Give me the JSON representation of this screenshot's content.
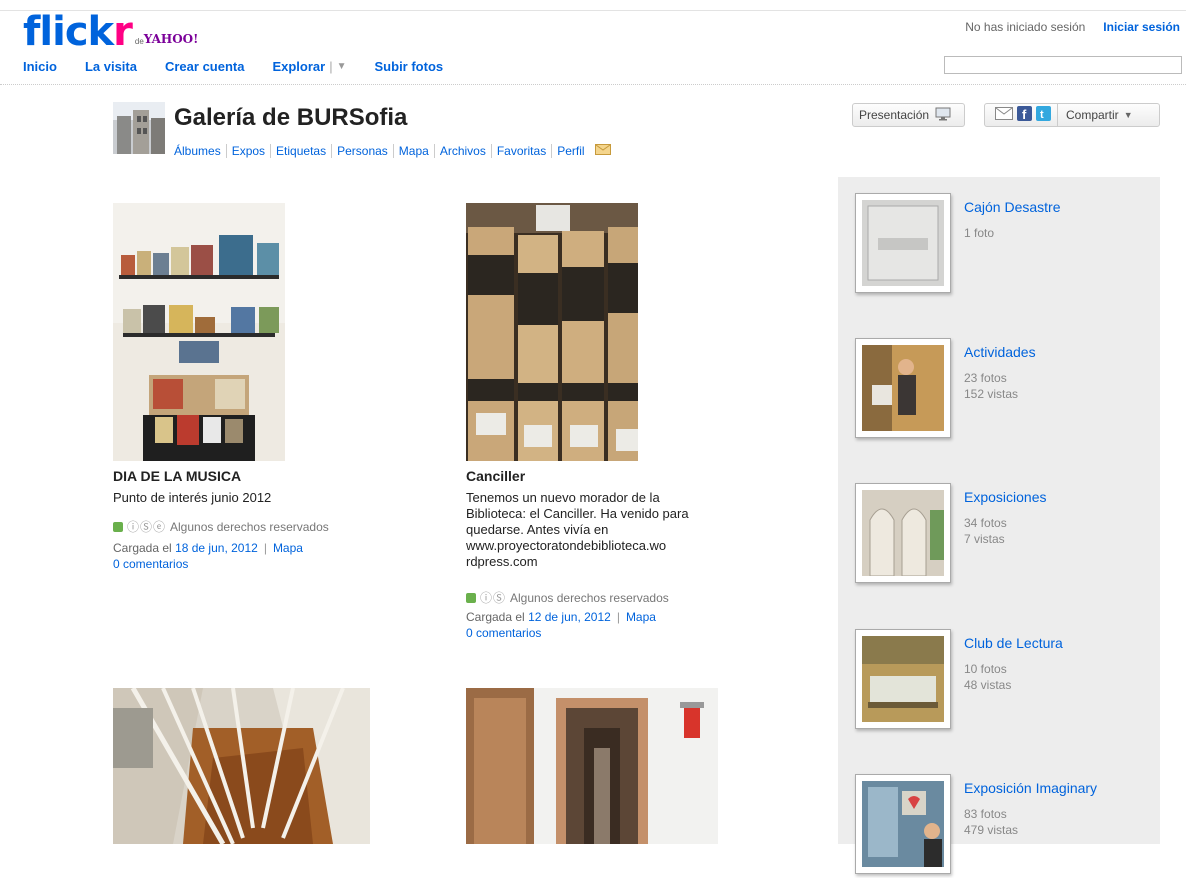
{
  "header": {
    "logo_flick": "flick",
    "logo_r": "r",
    "logo_de": "de",
    "logo_yahoo": "YAHOO!",
    "nav": [
      {
        "label": "Inicio"
      },
      {
        "label": "La visita"
      },
      {
        "label": "Crear cuenta"
      },
      {
        "label": "Explorar"
      },
      {
        "label": "Subir fotos"
      }
    ],
    "status_text": "No has iniciado sesión",
    "signin_label": "Iniciar sesión",
    "search_value": ""
  },
  "gallery": {
    "title": "Galería de BURSofia",
    "subnav": [
      "Álbumes",
      "Expos",
      "Etiquetas",
      "Personas",
      "Mapa",
      "Archivos",
      "Favoritas",
      "Perfil"
    ]
  },
  "toolbar": {
    "presentation_label": "Presentación",
    "share_label": "Compartir"
  },
  "photos": [
    {
      "title": "DIA DE LA MUSICA",
      "description": [
        "Punto de interés junio 2012"
      ],
      "license": "Algunos derechos reservados",
      "uploaded_prefix": "Cargada el",
      "uploaded_date": "18 de jun, 2012",
      "map_label": "Mapa",
      "comments": "0 comentarios"
    },
    {
      "title": "Canciller",
      "description": [
        "Tenemos un nuevo morador de la",
        "Biblioteca: el Canciller. Ha venido para",
        "quedarse. Antes vivía en",
        "www.proyectoratondebiblioteca.wo",
        "rdpress.com"
      ],
      "license": "Algunos derechos reservados",
      "uploaded_prefix": "Cargada el",
      "uploaded_date": "12 de jun, 2012",
      "map_label": "Mapa",
      "comments": "0 comentarios"
    }
  ],
  "sets": [
    {
      "title": "Cajón Desastre",
      "stats": [
        "1 foto"
      ]
    },
    {
      "title": "Actividades",
      "stats": [
        "23 fotos",
        "152 vistas"
      ]
    },
    {
      "title": "Exposiciones",
      "stats": [
        "34 fotos",
        "7 vistas"
      ]
    },
    {
      "title": "Club de Lectura",
      "stats": [
        "10 fotos",
        "48 vistas"
      ]
    },
    {
      "title": "Exposición Imaginary",
      "stats": [
        "83 fotos",
        "479 vistas"
      ]
    }
  ],
  "icons": {
    "presentation": "monitor-icon",
    "email": "email-icon",
    "facebook": "facebook-icon",
    "twitter": "twitter-icon",
    "dropdown": "caret-down-icon"
  },
  "colors": {
    "link": "#0063dc",
    "flickr_pink": "#ff0084",
    "sidebar_bg": "#ededed"
  }
}
